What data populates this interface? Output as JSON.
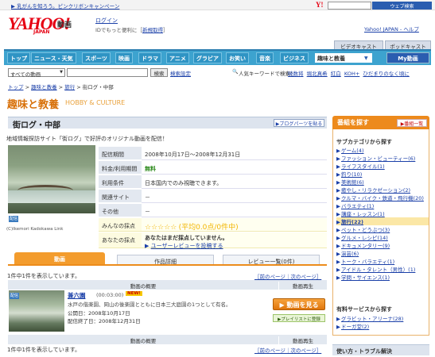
{
  "topbar": {
    "notice": "▶ 乳がんを知ろう。ピンクリボンキャンペーン",
    "y_logo": "Y!",
    "search_btn": "ウェブ検索"
  },
  "header": {
    "logo": "YAHOO!",
    "logo_sub": "JAPAN",
    "logo_service": "動画",
    "login": "ログイン",
    "login_sub_prefix": "IDでもっと便利に［",
    "login_sub_link": "新規取得",
    "login_sub_suffix": "］",
    "links": "Yahoo! JAPAN - ヘルプ"
  },
  "service_tabs": [
    "ビデオキャスト",
    "ポッドキャスト"
  ],
  "category_tabs": [
    "トップ",
    "ニュース・天気",
    "スポーツ",
    "映画",
    "ドラマ",
    "アニメ",
    "グラビア",
    "お笑い",
    "音楽",
    "ビジネス",
    "趣味と教養"
  ],
  "my_douga": "My動画",
  "search": {
    "select_value": "すべての動画",
    "button": "検索",
    "settings": "検索設定",
    "kw_label": "人気キーワードで検索：",
    "keywords": [
      "暁数将",
      "堀北真希",
      "紅白",
      "KOH+",
      "ひだまりのなく頃に"
    ]
  },
  "breadcrumb": [
    "トップ",
    "趣味と教養",
    "旅行",
    "街ログ・中部"
  ],
  "section": {
    "title": "趣味と教養",
    "title_en": "HOBBY & CULTURE"
  },
  "page": {
    "title": "街ログ・中部",
    "blogparts": "▶ブログパーツを貼る",
    "description": "地域情報探訪サイト「街ログ」で好評のオリジナル動画を配信！",
    "credit": "(C)Ikemori Kadokawa Link",
    "thumb_badge": "配信"
  },
  "info": {
    "rows": [
      {
        "label": "配信期間",
        "value": "2008年10月17日～2008年12月31日"
      },
      {
        "label": "料金/利用期間",
        "value": "無料"
      },
      {
        "label": "利用条件",
        "value": "日本国内でのみ視聴できます。"
      },
      {
        "label": "関連サイト",
        "value": "－"
      },
      {
        "label": "その他",
        "value": "－"
      }
    ],
    "rating_label": "みんなの採点",
    "rating_stars": "☆☆☆☆☆",
    "rating_text": "(平均0.0点/0件中)",
    "my_label": "あなたの採点",
    "my_text": "あなたはまだ採点していません。",
    "review_link": "ユーザーレビューを投稿する"
  },
  "tabs": [
    "動画",
    "作品詳細",
    "レビュー一覧(0件)"
  ],
  "list": {
    "count": "1件中1件を表示しています。",
    "pager": "［前のページ｜次のページ］",
    "col_summary": "動画の概要",
    "col_play": "動画再生",
    "items": [
      {
        "title": "兼六園",
        "duration": "(00:03:00)",
        "badge": "NEW!",
        "description": "水戸の偕楽園、岡山の後楽園とともに日本三大庭園の1つとして有名。",
        "published": "公開日：2008年10月17日",
        "end": "配信終了日：2008年12月31日",
        "watch": "▶ 動画を見る",
        "add_playlist": "▶プレイリストに登録",
        "thumb_badge": "配信"
      }
    ]
  },
  "right": {
    "title": "番組を探す",
    "list_btn": "▶番組一覧",
    "sub1": "サブカテゴリから探す",
    "categories": [
      "ゲーム(4)",
      "ファッション・ビューティー(6)",
      "ライフスタイル(1)",
      "釣り(10)",
      "美術館(6)",
      "癒やし・リラクゼーション(2)",
      "クルマ・バイク・鉄道・飛行機(20)",
      "バラエティ(1)",
      "講座・レッスン(1)",
      "旅行(22)",
      "ペット・どうぶつ(3)",
      "グルメ・レシピ(14)",
      "ドキュメンタリー(9)",
      "演芸(6)",
      "トーク・バラエティ(1)",
      "アイドル・タレント（男性）(1)",
      "学問・サイエンス(1)"
    ],
    "active_index": 9,
    "sub2": "有料サービスから探す",
    "paid": [
      "グラビット・アリーナ(28)",
      "ドーガ堂(2)"
    ],
    "help": "使い方・トラブル解決"
  },
  "colors": {
    "brand": "#e60012",
    "accent": "#ed8a1c",
    "nav": "#3da3cf",
    "link": "#1a3fa8"
  }
}
